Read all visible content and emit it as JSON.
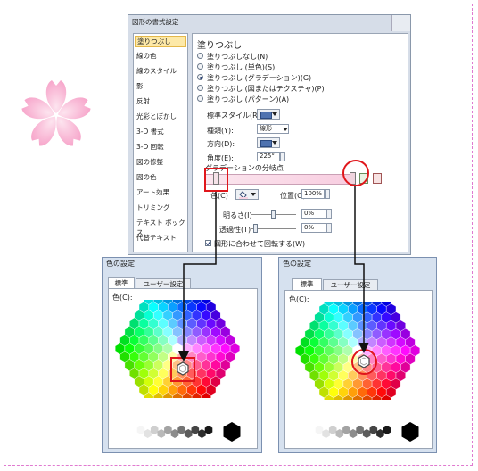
{
  "dialog": {
    "title": "図形の書式設定",
    "nav_items": [
      "塗りつぶし",
      "線の色",
      "線のスタイル",
      "影",
      "反射",
      "光彩とぼかし",
      "3-D 書式",
      "3-D 回転",
      "図の修整",
      "図の色",
      "アート効果",
      "トリミング",
      "テキスト ボックス",
      "代替テキスト"
    ],
    "section_title": "塗りつぶし",
    "fill_options": [
      {
        "label": "塗りつぶしなし(N)",
        "selected": false
      },
      {
        "label": "塗りつぶし (単色)(S)",
        "selected": false
      },
      {
        "label": "塗りつぶし (グラデーション)(G)",
        "selected": true
      },
      {
        "label": "塗りつぶし (図またはテクスチャ)(P)",
        "selected": false
      },
      {
        "label": "塗りつぶし (パターン)(A)",
        "selected": false
      }
    ],
    "preset_label": "標準スタイル(R):",
    "type_label": "種類(Y):",
    "type_value": "線形",
    "direction_label": "方向(D):",
    "angle_label": "角度(E):",
    "angle_value": "225°",
    "stops_label": "グラデーションの分岐点",
    "color_label": "色(C)",
    "position_label": "位置(O)",
    "position_value": "100%",
    "brightness_label": "明るさ(I)",
    "brightness_value": "0%",
    "transparency_label": "透過性(T)",
    "transparency_value": "0%",
    "rotate_label": "図形に合わせて回転する(W)",
    "rotate_checked": true
  },
  "color_dialogs": [
    {
      "title": "色の設定",
      "tab_standard": "標準",
      "tab_custom": "ユーザー設定",
      "colors_label": "色(C):"
    },
    {
      "title": "色の設定",
      "tab_standard": "標準",
      "tab_custom": "ユーザー設定",
      "colors_label": "色(C):"
    }
  ],
  "colors": {
    "highlight": "#e0161b",
    "accent_frame": "#e07ad0",
    "sakura": "#f9bfd9"
  }
}
